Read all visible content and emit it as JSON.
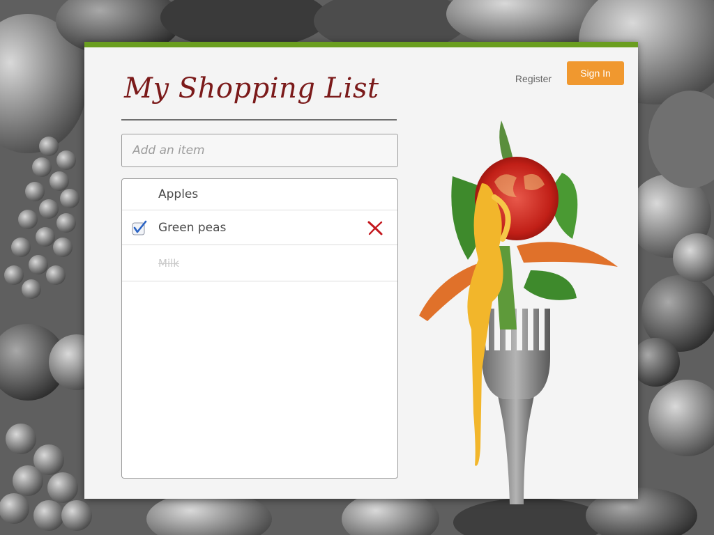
{
  "app": {
    "title": "My Shopping List",
    "accent_color": "#6a9e1f",
    "title_color": "#7b1a1a"
  },
  "header": {
    "register_label": "Register",
    "signin_label": "Sign In",
    "signin_color": "#f0982f"
  },
  "add_item": {
    "placeholder": "Add an item",
    "value": ""
  },
  "list": {
    "items": [
      {
        "label": "Apples",
        "checked": false,
        "strikethrough": false
      },
      {
        "label": "Green peas",
        "checked": true,
        "strikethrough": false
      },
      {
        "label": "Milk",
        "checked": false,
        "strikethrough": true
      }
    ]
  },
  "icons": {
    "checkbox": "checkbox-checked-icon",
    "delete": "delete-x-icon"
  }
}
